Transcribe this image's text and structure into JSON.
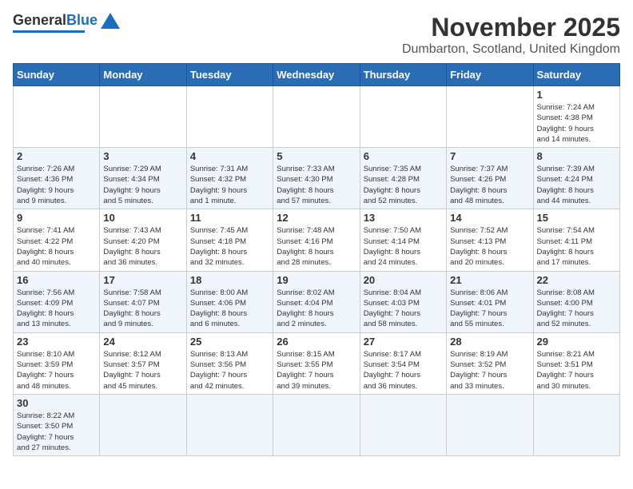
{
  "header": {
    "logo_text_general": "General",
    "logo_text_blue": "Blue",
    "main_title": "November 2025",
    "subtitle": "Dumbarton, Scotland, United Kingdom"
  },
  "calendar": {
    "headers": [
      "Sunday",
      "Monday",
      "Tuesday",
      "Wednesday",
      "Thursday",
      "Friday",
      "Saturday"
    ],
    "weeks": [
      [
        {
          "day": "",
          "info": ""
        },
        {
          "day": "",
          "info": ""
        },
        {
          "day": "",
          "info": ""
        },
        {
          "day": "",
          "info": ""
        },
        {
          "day": "",
          "info": ""
        },
        {
          "day": "",
          "info": ""
        },
        {
          "day": "1",
          "info": "Sunrise: 7:24 AM\nSunset: 4:38 PM\nDaylight: 9 hours\nand 14 minutes."
        }
      ],
      [
        {
          "day": "2",
          "info": "Sunrise: 7:26 AM\nSunset: 4:36 PM\nDaylight: 9 hours\nand 9 minutes."
        },
        {
          "day": "3",
          "info": "Sunrise: 7:29 AM\nSunset: 4:34 PM\nDaylight: 9 hours\nand 5 minutes."
        },
        {
          "day": "4",
          "info": "Sunrise: 7:31 AM\nSunset: 4:32 PM\nDaylight: 9 hours\nand 1 minute."
        },
        {
          "day": "5",
          "info": "Sunrise: 7:33 AM\nSunset: 4:30 PM\nDaylight: 8 hours\nand 57 minutes."
        },
        {
          "day": "6",
          "info": "Sunrise: 7:35 AM\nSunset: 4:28 PM\nDaylight: 8 hours\nand 52 minutes."
        },
        {
          "day": "7",
          "info": "Sunrise: 7:37 AM\nSunset: 4:26 PM\nDaylight: 8 hours\nand 48 minutes."
        },
        {
          "day": "8",
          "info": "Sunrise: 7:39 AM\nSunset: 4:24 PM\nDaylight: 8 hours\nand 44 minutes."
        }
      ],
      [
        {
          "day": "9",
          "info": "Sunrise: 7:41 AM\nSunset: 4:22 PM\nDaylight: 8 hours\nand 40 minutes."
        },
        {
          "day": "10",
          "info": "Sunrise: 7:43 AM\nSunset: 4:20 PM\nDaylight: 8 hours\nand 36 minutes."
        },
        {
          "day": "11",
          "info": "Sunrise: 7:45 AM\nSunset: 4:18 PM\nDaylight: 8 hours\nand 32 minutes."
        },
        {
          "day": "12",
          "info": "Sunrise: 7:48 AM\nSunset: 4:16 PM\nDaylight: 8 hours\nand 28 minutes."
        },
        {
          "day": "13",
          "info": "Sunrise: 7:50 AM\nSunset: 4:14 PM\nDaylight: 8 hours\nand 24 minutes."
        },
        {
          "day": "14",
          "info": "Sunrise: 7:52 AM\nSunset: 4:13 PM\nDaylight: 8 hours\nand 20 minutes."
        },
        {
          "day": "15",
          "info": "Sunrise: 7:54 AM\nSunset: 4:11 PM\nDaylight: 8 hours\nand 17 minutes."
        }
      ],
      [
        {
          "day": "16",
          "info": "Sunrise: 7:56 AM\nSunset: 4:09 PM\nDaylight: 8 hours\nand 13 minutes."
        },
        {
          "day": "17",
          "info": "Sunrise: 7:58 AM\nSunset: 4:07 PM\nDaylight: 8 hours\nand 9 minutes."
        },
        {
          "day": "18",
          "info": "Sunrise: 8:00 AM\nSunset: 4:06 PM\nDaylight: 8 hours\nand 6 minutes."
        },
        {
          "day": "19",
          "info": "Sunrise: 8:02 AM\nSunset: 4:04 PM\nDaylight: 8 hours\nand 2 minutes."
        },
        {
          "day": "20",
          "info": "Sunrise: 8:04 AM\nSunset: 4:03 PM\nDaylight: 7 hours\nand 58 minutes."
        },
        {
          "day": "21",
          "info": "Sunrise: 8:06 AM\nSunset: 4:01 PM\nDaylight: 7 hours\nand 55 minutes."
        },
        {
          "day": "22",
          "info": "Sunrise: 8:08 AM\nSunset: 4:00 PM\nDaylight: 7 hours\nand 52 minutes."
        }
      ],
      [
        {
          "day": "23",
          "info": "Sunrise: 8:10 AM\nSunset: 3:59 PM\nDaylight: 7 hours\nand 48 minutes."
        },
        {
          "day": "24",
          "info": "Sunrise: 8:12 AM\nSunset: 3:57 PM\nDaylight: 7 hours\nand 45 minutes."
        },
        {
          "day": "25",
          "info": "Sunrise: 8:13 AM\nSunset: 3:56 PM\nDaylight: 7 hours\nand 42 minutes."
        },
        {
          "day": "26",
          "info": "Sunrise: 8:15 AM\nSunset: 3:55 PM\nDaylight: 7 hours\nand 39 minutes."
        },
        {
          "day": "27",
          "info": "Sunrise: 8:17 AM\nSunset: 3:54 PM\nDaylight: 7 hours\nand 36 minutes."
        },
        {
          "day": "28",
          "info": "Sunrise: 8:19 AM\nSunset: 3:52 PM\nDaylight: 7 hours\nand 33 minutes."
        },
        {
          "day": "29",
          "info": "Sunrise: 8:21 AM\nSunset: 3:51 PM\nDaylight: 7 hours\nand 30 minutes."
        }
      ],
      [
        {
          "day": "30",
          "info": "Sunrise: 8:22 AM\nSunset: 3:50 PM\nDaylight: 7 hours\nand 27 minutes."
        },
        {
          "day": "",
          "info": ""
        },
        {
          "day": "",
          "info": ""
        },
        {
          "day": "",
          "info": ""
        },
        {
          "day": "",
          "info": ""
        },
        {
          "day": "",
          "info": ""
        },
        {
          "day": "",
          "info": ""
        }
      ]
    ]
  }
}
